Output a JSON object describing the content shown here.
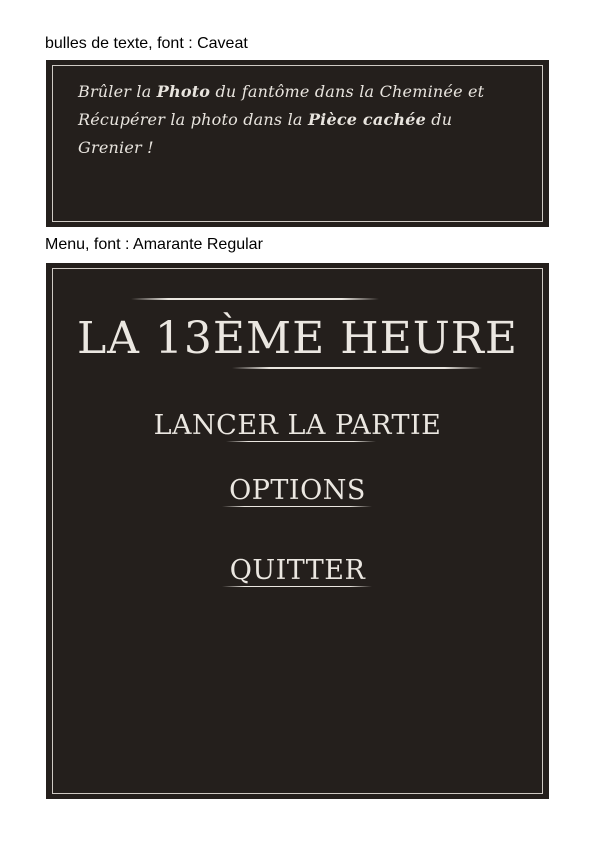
{
  "captions": {
    "bubble": "bulles de texte, font : Caveat",
    "menu": "Menu, font : Amarante Regular"
  },
  "bubble": {
    "line1_pre": "Brûler la ",
    "line1_bold": "Photo",
    "line1_post": " du fantôme dans la Cheminée et",
    "line2_pre": "Récupérer la photo dans la ",
    "line2_bold": "Pièce cachée",
    "line2_post": " du Grenier !"
  },
  "menu": {
    "title": "LA 13ÈME HEURE",
    "items": [
      {
        "label": "LANCER LA PARTIE"
      },
      {
        "label": "OPTIONS"
      },
      {
        "label": "QUITTER"
      }
    ]
  },
  "colors": {
    "panel_background": "#241f1c",
    "text": "#ebe7e1",
    "border": "#cfcac4"
  }
}
